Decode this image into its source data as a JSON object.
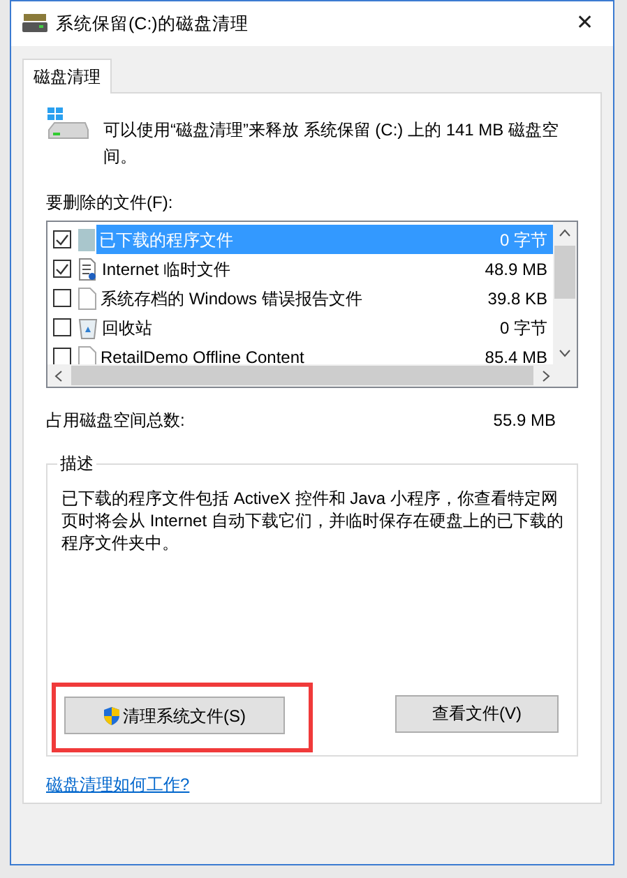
{
  "window": {
    "title": "系统保留(C:)的磁盘清理",
    "close": "✕"
  },
  "tabs": [
    {
      "label": "磁盘清理",
      "selected": true
    }
  ],
  "intro": "可以使用“磁盘清理”来释放 系统保留 (C:) 上的 141 MB 磁盘空间。",
  "files_label": "要删除的文件(F):",
  "files": [
    {
      "name": "已下载的程序文件",
      "size": "0 字节",
      "checked": true,
      "selected": true,
      "kind": "folder"
    },
    {
      "name": "Internet 临时文件",
      "size": "48.9 MB",
      "checked": true,
      "selected": false,
      "kind": "webdoc"
    },
    {
      "name": "系统存档的 Windows 错误报告文件",
      "size": "39.8 KB",
      "checked": false,
      "selected": false,
      "kind": "page"
    },
    {
      "name": "回收站",
      "size": "0 字节",
      "checked": false,
      "selected": false,
      "kind": "bin"
    },
    {
      "name": "RetailDemo Offline Content",
      "size": "85.4 MB",
      "checked": false,
      "selected": false,
      "kind": "page"
    }
  ],
  "total": {
    "label": "占用磁盘空间总数:",
    "value": "55.9 MB"
  },
  "description": {
    "title": "描述",
    "text": "已下载的程序文件包括 ActiveX 控件和 Java 小程序，你查看特定网页时将会从 Internet 自动下载它们，并临时保存在硬盘上的已下载的程序文件夹中。"
  },
  "buttons": [
    {
      "label": "清理系统文件(S)",
      "shield": true,
      "highlighted": true
    },
    {
      "label": "查看文件(V)",
      "shield": false,
      "highlighted": false
    }
  ],
  "help_link": "磁盘清理如何工作?"
}
